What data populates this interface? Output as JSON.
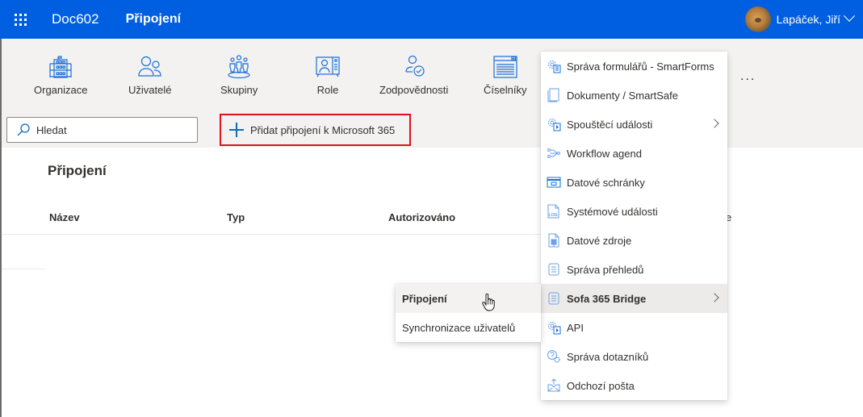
{
  "header": {
    "app_name": "Doc602",
    "page_name": "Připojení",
    "user_name": "Lapáček, Jiří",
    "brand_color": "#005ee0"
  },
  "toolbar": {
    "nav_items": [
      {
        "label": "Organizace",
        "icon": "building-icon"
      },
      {
        "label": "Uživatelé",
        "icon": "users-icon"
      },
      {
        "label": "Skupiny",
        "icon": "groups-icon"
      },
      {
        "label": "Role",
        "icon": "role-icon"
      },
      {
        "label": "Zodpovědnosti",
        "icon": "responsibility-icon"
      },
      {
        "label": "Číselníky",
        "icon": "codelist-icon"
      }
    ],
    "more_label": "...",
    "search_placeholder": "Hledat",
    "add_button_label": "Přidat připojení k Microsoft 365",
    "highlight_color": "#e0101d"
  },
  "content": {
    "title": "Připojení",
    "columns": [
      "Název",
      "Typ",
      "Autorizováno"
    ],
    "partial_column_mark": "e"
  },
  "menu": {
    "items": [
      {
        "label": "Správa formulářů - SmartForms",
        "icon": "forms-gear-icon",
        "submenu": false
      },
      {
        "label": "Dokumenty / SmartSafe",
        "icon": "documents-icon",
        "submenu": false
      },
      {
        "label": "Spouštěcí události",
        "icon": "trigger-gear-icon",
        "submenu": true
      },
      {
        "label": "Workflow agend",
        "icon": "workflow-icon",
        "submenu": false
      },
      {
        "label": "Datové schránky",
        "icon": "databox-icon",
        "submenu": false
      },
      {
        "label": "Systémové události",
        "icon": "log-file-icon",
        "submenu": false
      },
      {
        "label": "Datové zdroje",
        "icon": "datasource-icon",
        "submenu": false
      },
      {
        "label": "Správa přehledů",
        "icon": "list-icon",
        "submenu": false
      },
      {
        "label": "Sofa 365 Bridge",
        "icon": "list-icon",
        "submenu": true,
        "active": true
      },
      {
        "label": "API",
        "icon": "api-gear-icon",
        "submenu": false
      },
      {
        "label": "Správa dotazníků",
        "icon": "questionnaire-icon",
        "submenu": false
      },
      {
        "label": "Odchozí pošta",
        "icon": "outbox-icon",
        "submenu": false
      }
    ]
  },
  "submenu": {
    "items": [
      {
        "label": "Připojení",
        "active": true
      },
      {
        "label": "Synchronizace uživatelů",
        "active": false
      }
    ]
  }
}
